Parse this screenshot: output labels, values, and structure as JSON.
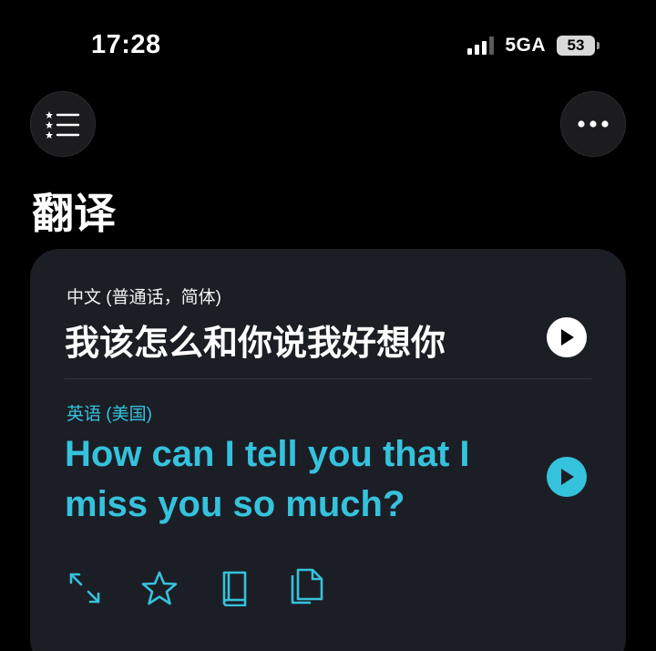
{
  "status_bar": {
    "time": "17:28",
    "network": "5GA",
    "battery": "53"
  },
  "header": {
    "title": "翻译",
    "left_button_icon": "starred-list-icon",
    "right_button_icon": "more-icon"
  },
  "card": {
    "source_language": "中文 (普通话，简体)",
    "source_text": "我该怎么和你说我好想你",
    "target_language": "英语 (美国)",
    "target_text": "How can I tell you that I miss you so much?",
    "actions": [
      "expand-icon",
      "star-icon",
      "book-icon",
      "copy-icon"
    ]
  },
  "colors": {
    "accent": "#35c2dc",
    "background": "#000000",
    "card": "#1c1e26"
  }
}
